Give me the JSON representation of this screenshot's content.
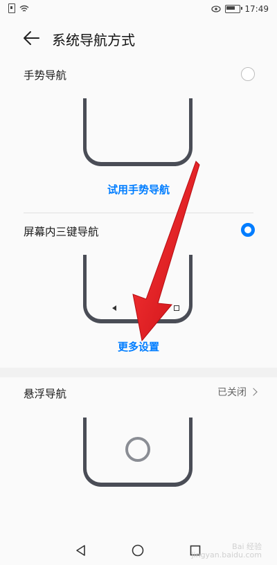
{
  "status": {
    "time": "17:49"
  },
  "header": {
    "title": "系统导航方式"
  },
  "gesture": {
    "label": "手势导航",
    "link": "试用手势导航",
    "selected": false
  },
  "three_key": {
    "label": "屏幕内三键导航",
    "link": "更多设置",
    "selected": true
  },
  "floating": {
    "label": "悬浮导航",
    "status": "已关闭"
  },
  "watermark": {
    "line1": "Bai 经验",
    "line2": "jingyan.baidu.com"
  },
  "colors": {
    "accent": "#007dff",
    "arrow": "#e8141b"
  }
}
